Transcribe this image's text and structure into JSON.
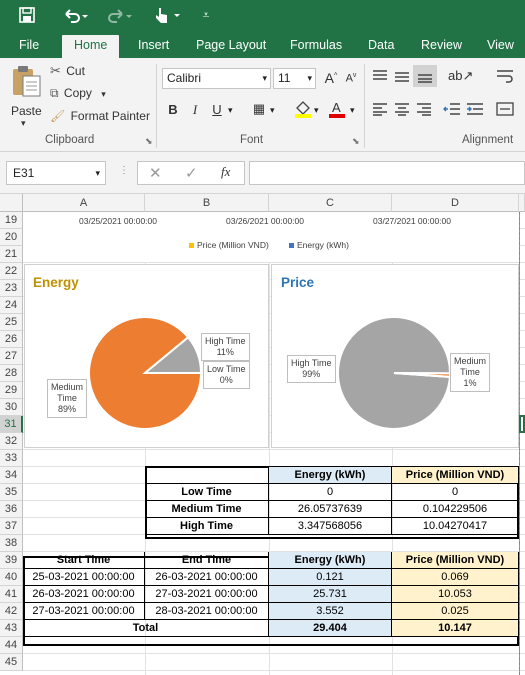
{
  "quick_access": {
    "undo_icon": "undo-icon",
    "redo_icon": "redo-icon",
    "touch_icon": "touch-icon",
    "customize_icon": "customize-icon"
  },
  "tabs": [
    "File",
    "Home",
    "Insert",
    "Page Layout",
    "Formulas",
    "Data",
    "Review",
    "View"
  ],
  "ribbon": {
    "paste": "Paste",
    "cut": "Cut",
    "copy": "Copy",
    "format_painter": "Format Painter",
    "clipboard_group": "Clipboard",
    "font_name": "Calibri",
    "font_size": "11",
    "font_group": "Font",
    "alignment_group": "Alignment",
    "bold": "B",
    "italic": "I",
    "underline": "U",
    "grow_font": "A",
    "shrink_font": "A"
  },
  "formula_bar": {
    "name_box": "E31",
    "fx": "fx",
    "value": ""
  },
  "columns": [
    "A",
    "B",
    "C",
    "D"
  ],
  "rows": [
    "19",
    "20",
    "21",
    "22",
    "23",
    "24",
    "25",
    "26",
    "27",
    "28",
    "29",
    "30",
    "31",
    "32",
    "33",
    "34",
    "35",
    "36",
    "37",
    "38",
    "39",
    "40",
    "41",
    "42",
    "43",
    "44",
    "45"
  ],
  "top_strip": {
    "dates": [
      "03/25/2021 00:00:00",
      "03/26/2021 00:00:00",
      "03/27/2021 00:00:00"
    ],
    "legend": [
      "Price (Million VND)",
      "Energy (kWh)"
    ]
  },
  "colors": {
    "excel_green": "#217346",
    "orange": "#ed7d31",
    "gray": "#a5a5a5",
    "gold": "#ffc000",
    "blue": "#4472c4",
    "energy_title": "#bf9000",
    "price_title": "#2e75b6",
    "header_blue": "#ddebf7",
    "header_yellow": "#fff2cc"
  },
  "chart_data": [
    {
      "type": "pie",
      "title": "Energy",
      "categories": [
        "Medium Time",
        "High Time",
        "Low Time"
      ],
      "values": [
        89,
        11,
        0
      ],
      "labels": [
        "Medium\nTime\n89%",
        "High Time\n11%",
        "Low Time\n0%"
      ]
    },
    {
      "type": "pie",
      "title": "Price",
      "categories": [
        "High Time",
        "Medium Time",
        "Low Time"
      ],
      "values": [
        99,
        1,
        0
      ],
      "labels": [
        "High Time\n99%",
        "Medium\nTime\n1%"
      ]
    }
  ],
  "summary_table": {
    "headers": [
      "",
      "Energy (kWh)",
      "Price (Million VND)"
    ],
    "rows": [
      [
        "Low Time",
        "0",
        "0"
      ],
      [
        "Medium Time",
        "26.05737639",
        "0.104229506"
      ],
      [
        "High Time",
        "3.347568056",
        "10.04270417"
      ]
    ]
  },
  "detail_table": {
    "headers": [
      "Start Time",
      "End Time",
      "Energy (kWh)",
      "Price (Million VND)"
    ],
    "rows": [
      [
        "25-03-2021 00:00:00",
        "26-03-2021 00:00:00",
        "0.121",
        "0.069"
      ],
      [
        "26-03-2021 00:00:00",
        "27-03-2021 00:00:00",
        "25.731",
        "10.053"
      ],
      [
        "27-03-2021 00:00:00",
        "28-03-2021 00:00:00",
        "3.552",
        "0.025"
      ]
    ],
    "total_label": "Total",
    "total_energy": "29.404",
    "total_price": "10.147"
  }
}
